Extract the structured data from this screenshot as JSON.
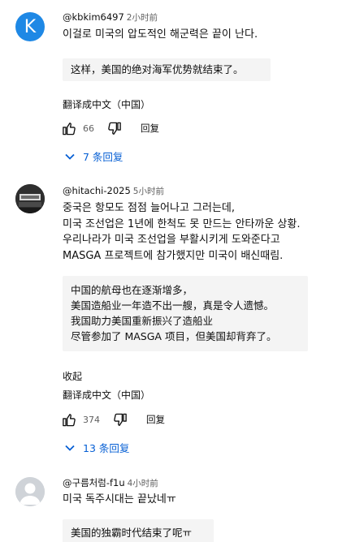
{
  "comments": [
    {
      "author": "@kbkim6497",
      "time": "2小时前",
      "avatar_letter": "K",
      "text_lines": [
        "이걸로 미국의 압도적인 해군력은 끝이 난다."
      ],
      "translation_lines": [
        "这样，美国的绝对海军优势就结束了。"
      ],
      "translate_label": "翻译成中文（中国）",
      "likes": "66",
      "reply_label": "回复",
      "replies_label": "7 条回复"
    },
    {
      "author": "@hitachi-2025",
      "time": "5小时前",
      "text_lines": [
        "중국은 항모도 점점 늘어나고 그러는데,",
        "미국 조선업은 1년에 한척도 못 만드는 안타까운 상황.",
        "우리나라가 미국 조선업을 부활시키게 도와준다고",
        "MASGA 프로젝트에 참가했지만 미국이 배신때림."
      ],
      "translation_lines": [
        "中国的航母也在逐渐增多，",
        "美国造船业一年造不出一艘，真是令人遗憾。",
        "我国助力美国重新振兴了造船业",
        "尽管参加了 MASGA 项目，但美国却背弃了。"
      ],
      "collapse_label": "收起",
      "translate_label": "翻译成中文（中国）",
      "likes": "374",
      "reply_label": "回复",
      "replies_label": "13 条回复"
    },
    {
      "author": "@구름처럼-f1u",
      "time": "4小时前",
      "text_lines": [
        "미국 독주시대는 끝났네ㅠ"
      ],
      "translation_lines": [
        "美国的独霸时代结束了呢ㅠ"
      ]
    }
  ],
  "colors": {
    "link_blue": "#065fd4",
    "avatar_k": "#1e88e5",
    "translation_bg": "#f4f4f4",
    "meta_gray": "#606060"
  }
}
